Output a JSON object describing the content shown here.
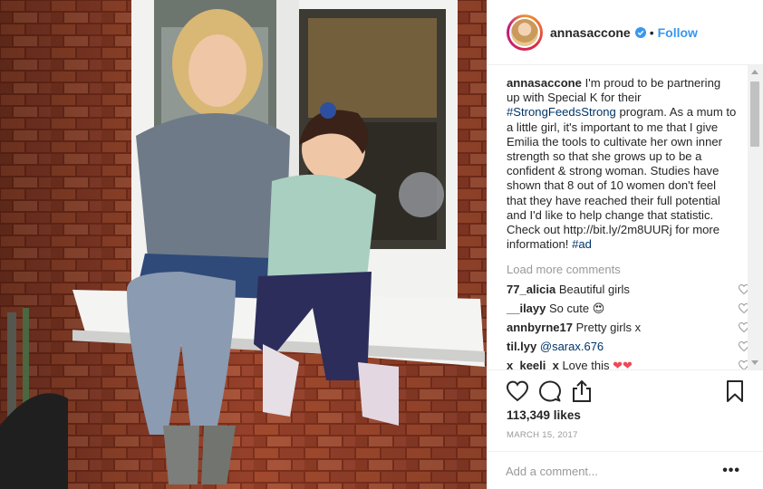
{
  "header": {
    "username": "annasaccone",
    "dot": "•",
    "follow_label": "Follow"
  },
  "caption": {
    "username": "annasaccone",
    "text_before": " I'm proud to be partnering up with Special K for their ",
    "hashtag": "#StrongFeedsStrong",
    "text_after": " program. As a mum to a little girl, it's important to me that I give Emilia the tools to cultivate her own inner strength so that she grows up to be a confident & strong woman. Studies have shown that 8 out of 10 women don't feel that they have reached their full potential and I'd like to help change that statistic. Check out http://bit.ly/2m8UURj for more information! ",
    "hashtag2": "#ad"
  },
  "load_more_label": "Load more comments",
  "comments": [
    {
      "user": "77_alicia",
      "text": " Beautiful girls",
      "mention": "",
      "emoji": ""
    },
    {
      "user": "__ilayy",
      "text": " So cute ",
      "mention": "",
      "emoji": "😍"
    },
    {
      "user": "annbyrne17",
      "text": " Pretty girls x",
      "mention": "",
      "emoji": ""
    },
    {
      "user": "til.lyy",
      "text": " ",
      "mention": "@sarax.676",
      "emoji": ""
    },
    {
      "user": "x_keeli_x",
      "text": " Love this ",
      "mention": "",
      "emoji": "❤❤"
    }
  ],
  "likes_label": "113,349 likes",
  "date_label": "MARCH 15, 2017",
  "add_comment_placeholder": "Add a comment...",
  "more_label": "•••",
  "colors": {
    "link": "#3897f0",
    "hashtag": "#003569",
    "muted": "#999999",
    "heart": "#ed4956"
  },
  "icons": [
    "like-heart-icon",
    "comment-icon",
    "share-icon",
    "bookmark-icon",
    "verified-icon",
    "comment-like-icon"
  ]
}
